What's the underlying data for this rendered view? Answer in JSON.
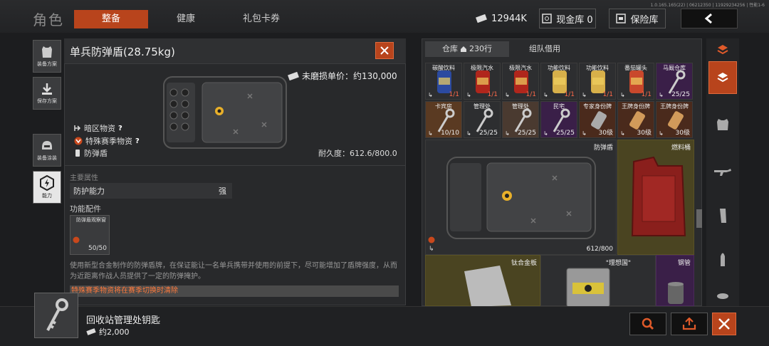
{
  "header": {
    "title": "角色",
    "tabs": [
      "整备",
      "健康",
      "礼包卡券"
    ],
    "version": "1.0.165.165(22) | 06212350 | 11929234256 | 性能1-6",
    "currency": "12944K",
    "cash_vault": "现金库 0",
    "safe": "保险库"
  },
  "sidebar": [
    {
      "label": "装备方案",
      "icon": "vest-icon"
    },
    {
      "label": "保存方案",
      "icon": "save-icon"
    },
    {
      "label": "装备涂装",
      "icon": "helmet-icon"
    },
    {
      "label": "能力",
      "icon": "ability-icon"
    }
  ],
  "detail": {
    "title": "单兵防弹盾(28.75kg)",
    "price_label": "未磨损单价：约130,000",
    "tags": [
      {
        "text": "暗区物资",
        "q": "?"
      },
      {
        "text": "特殊赛季物资",
        "q": "?"
      },
      {
        "text": "防弹盾",
        "q": ""
      }
    ],
    "durability": "耐久度：612.6/800.0",
    "main_attr_label": "主要属性",
    "attr_name": "防护能力",
    "attr_value": "强",
    "parts_label": "功能配件",
    "part_name": "防弹盾观察窗",
    "part_count": "50/50",
    "description": "使用新型合金制作的防弹盾牌，在保证能让一名单兵携带并使用的前提下，尽可能增加了盾牌强度，从而为近距离作战人员提供了一定的防弹掩护。",
    "warning": "特殊赛季物资将在赛季切换时清除"
  },
  "storage": {
    "tab_warehouse": "仓库",
    "tab_rows": "230行",
    "tab_team": "组队借用",
    "row1": [
      {
        "name": "碳酸饮料",
        "count": "1/1",
        "red": true,
        "color": "#2b4aa0"
      },
      {
        "name": "极限汽水",
        "count": "1/1",
        "red": true,
        "color": "#b0261c"
      },
      {
        "name": "极限汽水",
        "count": "1/1",
        "red": true,
        "color": "#b0261c"
      },
      {
        "name": "功能饮料",
        "count": "1/1",
        "red": true,
        "color": "#d7b04a"
      },
      {
        "name": "功能饮料",
        "count": "1/1",
        "red": true,
        "color": "#d7b04a"
      },
      {
        "name": "番茄罐头",
        "count": "1/1",
        "red": true,
        "color": "#c9482c"
      },
      {
        "name": "马厩仓库",
        "count": "25/25",
        "red": false,
        "color": "#aaaaaa"
      }
    ],
    "row2": [
      {
        "name": "卡宾房",
        "count": "10/10",
        "color": "#aaaaaa"
      },
      {
        "name": "管理处",
        "count": "25/25",
        "color": "#aaaaaa"
      },
      {
        "name": "管理处",
        "count": "25/25",
        "color": "#aaaaaa"
      },
      {
        "name": "民宅",
        "count": "25/25",
        "color": "#aaaaaa"
      },
      {
        "name": "专家身份牌",
        "count": "30级",
        "color": "#aaaaaa"
      },
      {
        "name": "王牌身份牌",
        "count": "30级",
        "color": "#d19a5a"
      },
      {
        "name": "王牌身份牌",
        "count": "30级",
        "color": "#d19a5a"
      }
    ],
    "big_shield_name": "防弹盾",
    "big_shield_dur": "612/800",
    "fuel_name": "燃料桶",
    "ti_name": "钛合金板",
    "ideal_name": "\"理想国\"",
    "pipe_name": "钢管"
  },
  "bottom": {
    "item_name": "回收站管理处钥匙",
    "item_price": "约2,000"
  }
}
